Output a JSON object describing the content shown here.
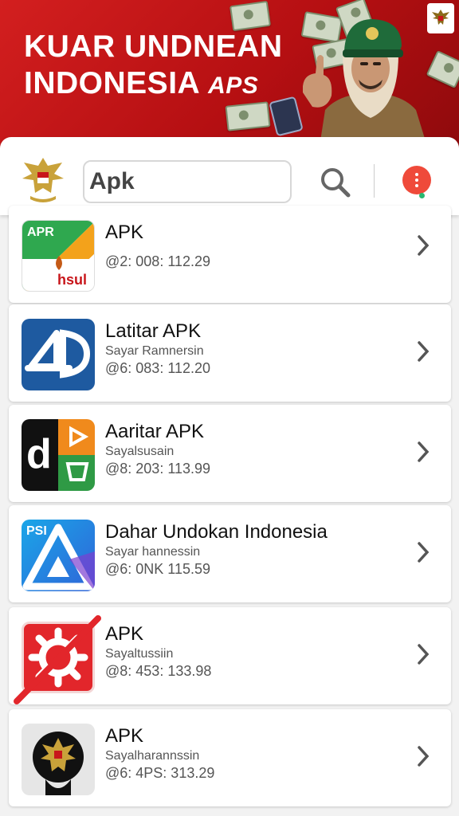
{
  "banner": {
    "title_line1": "KUAR UNDNEAN",
    "title_line2": "INDONESIA",
    "title_suffix": "APS"
  },
  "search": {
    "value": "Apk"
  },
  "colors": {
    "brand_red": "#c8161b",
    "menu_button": "#ef4a3a"
  },
  "icons": {
    "search": "search-icon",
    "menu": "more-vertical-icon",
    "chevron": "chevron-right-icon"
  },
  "apps": [
    {
      "name": "APK",
      "subtitle": "",
      "meta": "@2: 008: 112.29",
      "icon_label_top": "APR",
      "icon_label_bottom": "hsul"
    },
    {
      "name": "Latitar APK",
      "subtitle": "Sayar Ramnersin",
      "meta": "@6: 083: 112.20"
    },
    {
      "name": "Aaritar APK",
      "subtitle": "Sayalsusain",
      "meta": "@8: 203: 113.99",
      "icon_letter": "d"
    },
    {
      "name": "Dahar Undokan Indonesia",
      "subtitle": "Sayar hannessin",
      "meta": "@6: 0NK 115.59",
      "icon_label_top": "PSI"
    },
    {
      "name": "APK",
      "subtitle": "Sayaltussiin",
      "meta": "@8: 453: 133.98"
    },
    {
      "name": "APK",
      "subtitle": "Sayalharannssin",
      "meta": "@6: 4PS: 313.29"
    }
  ]
}
